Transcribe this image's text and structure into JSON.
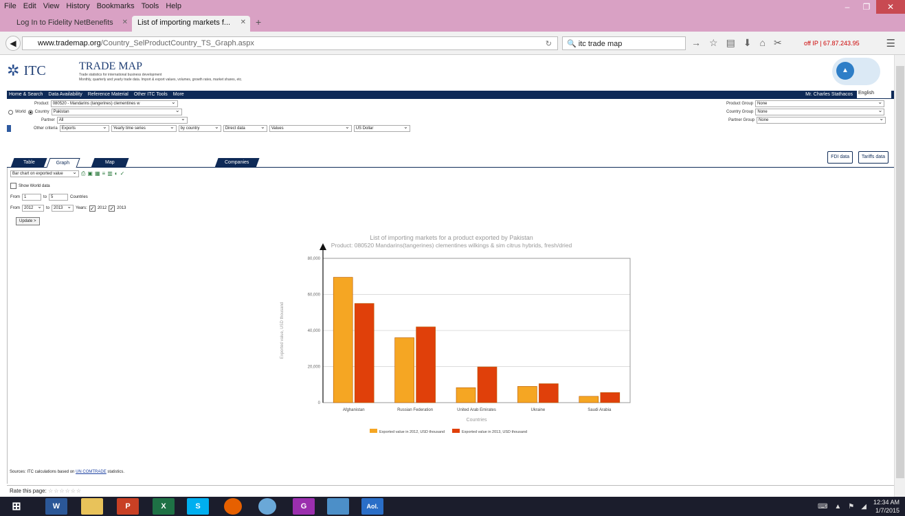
{
  "browser": {
    "menu": [
      "File",
      "Edit",
      "View",
      "History",
      "Bookmarks",
      "Tools",
      "Help"
    ],
    "tabs": [
      {
        "label": "Log In to Fidelity NetBenefits",
        "active": false
      },
      {
        "label": "List of importing markets f...",
        "active": true
      }
    ],
    "url_host": "www.trademap.org",
    "url_path": "/Country_SelProductCountry_TS_Graph.aspx",
    "search_value": "itc trade map",
    "ip_text": "off IP | 67.87.243.95"
  },
  "header": {
    "logo_text": "ITC",
    "title": "TRADE MAP",
    "subtitle_1": "Trade statistics for international business development",
    "subtitle_2": "Monthly, quarterly and yearly trade data. Import & export values, volumes, growth rates, market shares, etc."
  },
  "nav": {
    "items": [
      "Home & Search",
      "Data Availability",
      "Reference Material",
      "Other ITC Tools",
      "More"
    ],
    "user": "Mr. Charles Stathacos",
    "language": "English"
  },
  "criteria": {
    "product_label": "Product",
    "product_value": "080520 - Mandarins (tangerines) clementines w",
    "world_label": "World",
    "country_label": "Country",
    "country_value": "Pakistan",
    "partner_label": "Partner",
    "partner_value": "All",
    "other_label": "Other criteria",
    "exports": "Exports",
    "series": "Yearly time series",
    "by": "by country",
    "direct": "Direct data",
    "values": "Values",
    "currency": "US Dollar",
    "product_group_label": "Product Group",
    "product_group_value": "None",
    "country_group_label": "Country Group",
    "country_group_value": "None",
    "partner_group_label": "Partner Group",
    "partner_group_value": "None"
  },
  "tabs": {
    "table": "Table",
    "graph": "Graph",
    "map": "Map",
    "companies": "Companies",
    "fdi": "FDI data",
    "tariffs": "Tariffs data"
  },
  "graph_controls": {
    "chart_select": "Bar chart on exported value",
    "show_world": "Show World data",
    "from_label": "From",
    "from_value": "1",
    "to_label": "to",
    "to_value": "5",
    "countries_label": "Countries",
    "from_year": "2012",
    "to_year": "2013",
    "years_label": "Years:",
    "year_1": "2012",
    "year_2": "2013",
    "update": "Update >"
  },
  "chart_data": {
    "type": "bar",
    "title": "List of importing markets for a product exported by Pakistan",
    "subtitle": "Product: 080520 Mandarins(tangerines) clementines wilkings & sim citrus hybrids, fresh/dried",
    "xlabel": "Countries",
    "ylabel": "Exported value, USD thousand",
    "ylim": [
      0,
      80000
    ],
    "yticks": [
      0,
      20000,
      40000,
      60000,
      80000
    ],
    "ytick_labels": [
      "0",
      "20,000",
      "40,000",
      "60,000",
      "80,000"
    ],
    "categories": [
      "Afghanistan",
      "Russian Federation",
      "United Arab Emirates",
      "Ukraine",
      "Saudi Arabia"
    ],
    "series": [
      {
        "name": "Exported value in 2012, USD thousand",
        "color": "#f5a623",
        "values": [
          69500,
          36000,
          8300,
          9000,
          3500
        ]
      },
      {
        "name": "Exported value in 2013, USD thousand",
        "color": "#e0400a",
        "values": [
          55000,
          42000,
          19800,
          10500,
          5600
        ]
      }
    ],
    "legend": "bottom",
    "grid": true
  },
  "footer": {
    "source_prefix": "Sources: ITC calculations based on",
    "source_link": "UN COMTRADE",
    "source_suffix": "statistics.",
    "rate_label": "Rate this page:"
  },
  "taskbar": {
    "apps": [
      "W",
      "",
      "P",
      "X",
      "S",
      "",
      "",
      "G",
      "",
      "Aol."
    ],
    "time": "12:34 AM",
    "date": "1/7/2015"
  }
}
